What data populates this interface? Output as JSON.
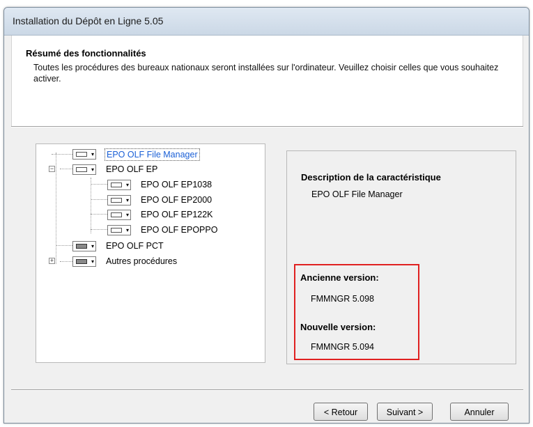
{
  "window": {
    "title": "Installation du Dépôt en Ligne 5.05"
  },
  "header": {
    "title": "Résumé des fonctionnalités",
    "description": "Toutes les procédures des bureaux nationaux seront installées sur l'ordinateur. Veuillez choisir celles que vous souhaitez activer."
  },
  "tree": {
    "items": [
      {
        "label": "EPO OLF File Manager",
        "selected": true
      },
      {
        "label": "EPO OLF EP",
        "expanded": true
      },
      {
        "label": "EPO OLF EP1038"
      },
      {
        "label": "EPO OLF EP2000"
      },
      {
        "label": "EPO OLF EP122K"
      },
      {
        "label": "EPO OLF EPOPPO"
      },
      {
        "label": "EPO OLF PCT"
      },
      {
        "label": "Autres procédures",
        "expanded": false
      }
    ],
    "expander_expanded": "−",
    "expander_collapsed": "+",
    "dropdown_arrow": "▾"
  },
  "description": {
    "title": "Description de la caractéristique",
    "value": "EPO OLF File Manager"
  },
  "versions": {
    "old_label": "Ancienne version:",
    "old_value": "FMMNGR  5.098",
    "new_label": "Nouvelle version:",
    "new_value": "FMMNGR  5.094",
    "highlight_color": "#e02020"
  },
  "buttons": {
    "back": "< Retour",
    "next": "Suivant >",
    "cancel": "Annuler"
  },
  "colors": {
    "selected_text": "#1a5fd6",
    "panel_bg": "#f0f0f0"
  }
}
